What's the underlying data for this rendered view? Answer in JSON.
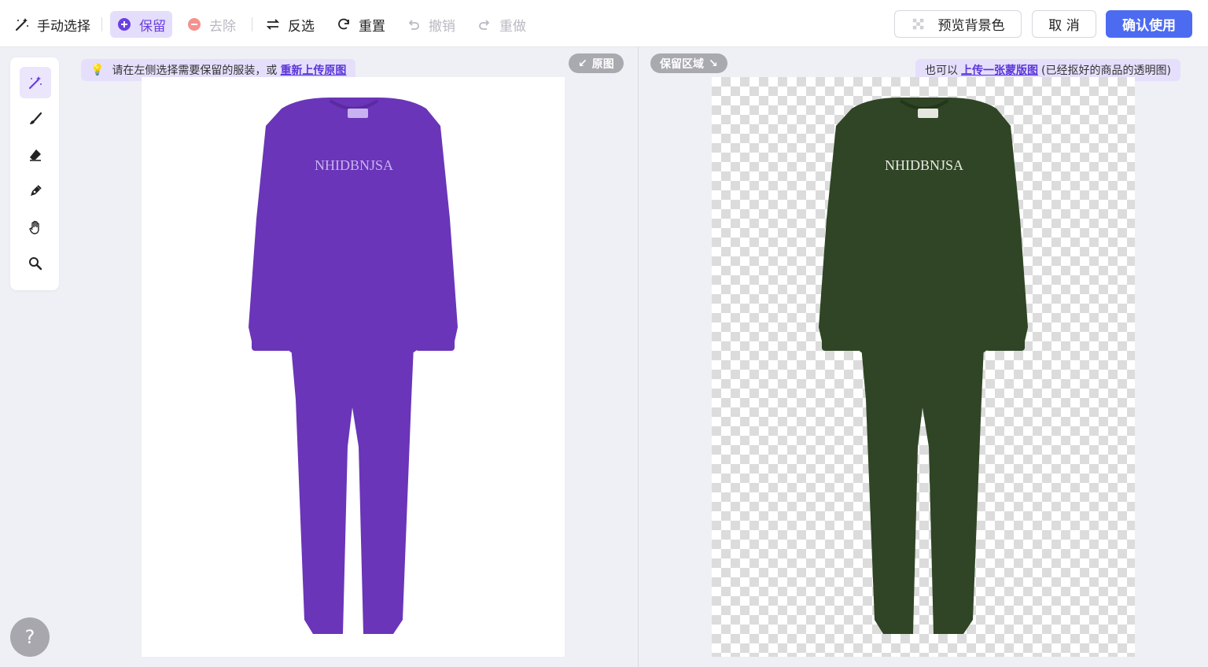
{
  "toolbar": {
    "manual_select": "手动选择",
    "keep": "保留",
    "remove": "去除",
    "invert": "反选",
    "reset": "重置",
    "undo": "撤销",
    "redo": "重做",
    "preview_bg": "预览背景色",
    "cancel": "取 消",
    "confirm": "确认使用"
  },
  "left_panel": {
    "hint_text": "请在左侧选择需要保留的服装，或",
    "hint_link": "重新上传原图",
    "pill": "原图",
    "garment_print": "NHIDBNJSA",
    "garment_color": "#6a35b8"
  },
  "right_panel": {
    "pill": "保留区域",
    "hint_prefix": "也可以",
    "hint_link": "上传一张蒙版图",
    "hint_suffix": "(已经抠好的商品的透明图)",
    "garment_print": "NHIDBNJSA",
    "garment_color": "#2f4525"
  },
  "tools": [
    "magic-wand-icon",
    "brush-icon",
    "eraser-icon",
    "pen-icon",
    "hand-icon",
    "zoom-icon"
  ],
  "help_label": "?",
  "colors": {
    "accent": "#4d6bf1",
    "keep_purple": "#6a3fe0",
    "remove_red": "#f08080"
  }
}
